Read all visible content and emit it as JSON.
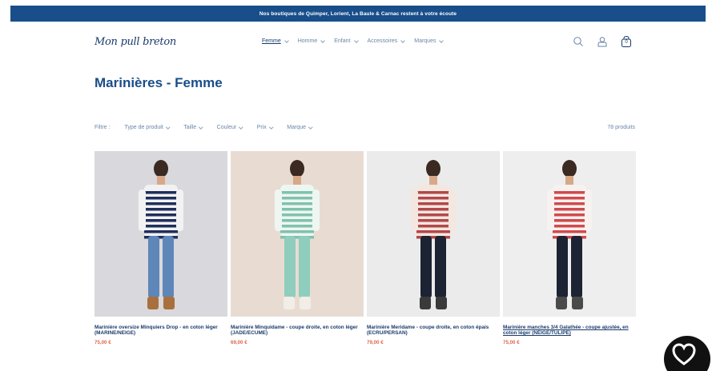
{
  "announcement": "Nos boutiques de Quimper, Lorient, La Baule & Carnac restent à votre écoute",
  "logo": "Mon pull breton",
  "nav": [
    {
      "label": "Femme",
      "active": true
    },
    {
      "label": "Homme",
      "active": false
    },
    {
      "label": "Enfant",
      "active": false
    },
    {
      "label": "Accessoires",
      "active": false
    },
    {
      "label": "Marques",
      "active": false
    }
  ],
  "header_icons": [
    "search-icon",
    "account-icon",
    "cart-icon"
  ],
  "cart_count": "0",
  "page_title": "Marinières - Femme",
  "filters": {
    "label": "Filtre :",
    "items": [
      "Type de produit",
      "Taille",
      "Couleur",
      "Prix",
      "Marque"
    ]
  },
  "product_count": "78 produits",
  "products": [
    {
      "name": "Marinière oversize Minquiers Drop - en coton léger (MARINE/NEIGE)",
      "price": "75,00 €",
      "bg": "#d9d8dc",
      "stripe_a": "#1f2f5c",
      "stripe_b": "#f2f2f2",
      "pants": "#5f86b8",
      "shoes": "#a8703e"
    },
    {
      "name": "Marinière Minquidame - coupe droite, en coton léger (JADE/ECUME)",
      "price": "69,00 €",
      "bg": "#e8dcd2",
      "stripe_a": "#7fc2ae",
      "stripe_b": "#eef6f2",
      "pants": "#8fcdbd",
      "shoes": "#f2ede6"
    },
    {
      "name": "Marinière Meridame - coupe droite, en coton épais (ECRU/PERSAN)",
      "price": "79,00 €",
      "bg": "#ebebeb",
      "stripe_a": "#b2484a",
      "stripe_b": "#f3e7e0",
      "pants": "#1c2333",
      "shoes": "#3a3a3a"
    },
    {
      "name": "Marinière manches 3/4 Galathée - coupe ajustée, en coton léger (NEIGE/TULIPE)",
      "price": "75,00 €",
      "bg": "#eeeeee",
      "stripe_a": "#d14a4e",
      "stripe_b": "#f7f2ef",
      "pants": "#1c2333",
      "shoes": "#4a4a4a"
    }
  ],
  "colors": {
    "brand": "#184e8a",
    "price": "#e0654e"
  }
}
